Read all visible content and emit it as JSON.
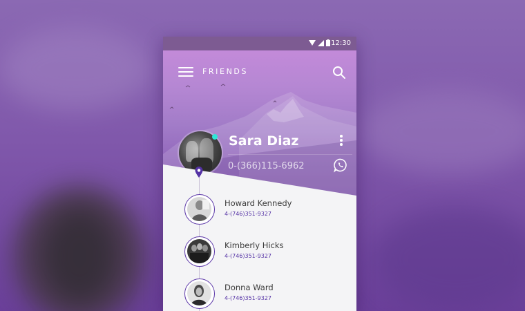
{
  "status_bar": {
    "time": "12:30",
    "icons": [
      "wifi-icon",
      "signal-icon",
      "battery-icon"
    ]
  },
  "header": {
    "title": "FRIENDS",
    "menu_icon": "hamburger-icon",
    "search_icon": "search-icon"
  },
  "profile": {
    "name": "Sara Diaz",
    "phone": "0-(366)115-6962",
    "online": true,
    "more_icon": "more-vertical-icon",
    "call_icon": "whatsapp-icon"
  },
  "contacts": [
    {
      "name": "Howard Kennedy",
      "phone": "4-(746)351-9327"
    },
    {
      "name": "Kimberly Hicks",
      "phone": "4-(746)351-9327"
    },
    {
      "name": "Donna Ward",
      "phone": "4-(746)351-9327"
    }
  ],
  "colors": {
    "accent": "#5432a5",
    "online": "#2ee6d6",
    "header_top": "#c38ad9",
    "header_bottom": "#7b4ea7"
  }
}
